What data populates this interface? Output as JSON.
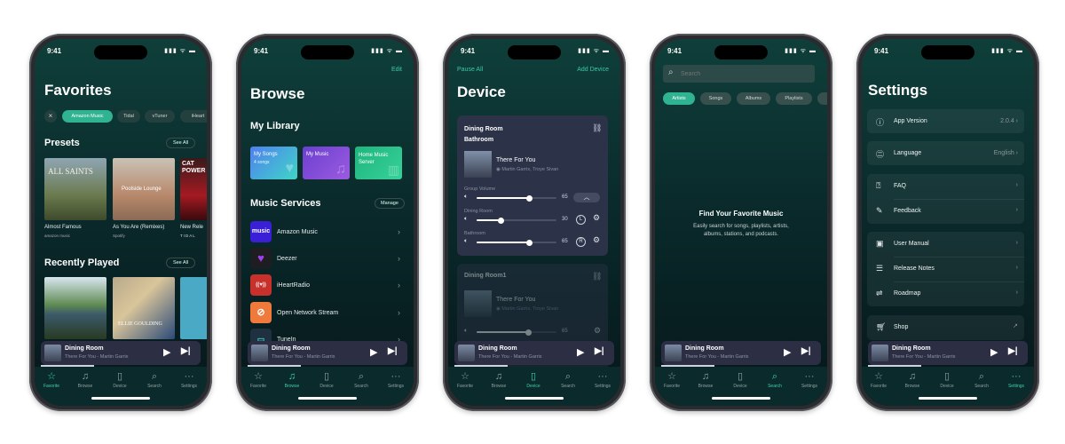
{
  "status": {
    "time": "9:41",
    "icons": "▮▮▮ ᯤ ▬"
  },
  "mini_player": {
    "title": "Dining Room",
    "subtitle": "There For You - Martin Garrix",
    "play_icon": "play-icon",
    "next_icon": "skip-next-icon"
  },
  "tab_bar": {
    "items": [
      {
        "label": "Favorite",
        "icon": "☆"
      },
      {
        "label": "Browse",
        "icon": "♫"
      },
      {
        "label": "Device",
        "icon": "▯"
      },
      {
        "label": "Search",
        "icon": "⌕"
      },
      {
        "label": "Settings",
        "icon": "···"
      }
    ]
  },
  "favorites": {
    "title": "Favorites",
    "chips": [
      "Amazon Music",
      "Tidal",
      "vTuner",
      "iHeart"
    ],
    "presets_title": "Presets",
    "see_all": "See All",
    "presets": [
      {
        "title": "Almost Famous",
        "source": "amazon music",
        "art_text": "ALL SAINTS"
      },
      {
        "title": "As You Are (Remixes)",
        "source": "Spotify",
        "art_text": "Poolside Lounge"
      },
      {
        "title": "New Rele",
        "source": "TIDAL",
        "art_text": "CAT POWER"
      }
    ],
    "recent_title": "Recently Played",
    "recent_art_text": "ELLIE GOULDING"
  },
  "browse": {
    "edit": "Edit",
    "title": "Browse",
    "library_title": "My Library",
    "library": [
      {
        "title": "My Songs",
        "sub": "4 songs",
        "color": "linear-gradient(135deg,#4f7ff0,#3fd6c6)"
      },
      {
        "title": "My Music",
        "sub": "",
        "color": "linear-gradient(135deg,#6a3fcf,#9c5be0)"
      },
      {
        "title": "Home Music Server",
        "sub": "",
        "color": "linear-gradient(135deg,#1fb57d,#36d19a)"
      }
    ],
    "services_title": "Music Services",
    "manage": "Manage",
    "services": [
      {
        "name": "Amazon Music",
        "icon_text": "music",
        "color": "#3b1fd6"
      },
      {
        "name": "Deezer",
        "icon_text": "♥",
        "color": "#1d1d22"
      },
      {
        "name": "iHeartRadio",
        "icon_text": "((♥))",
        "color": "#c8302c"
      },
      {
        "name": "Open Network Stream",
        "icon_text": "⊘",
        "color": "#f07a3b"
      },
      {
        "name": "TuneIn",
        "icon_text": "▭",
        "color": "#1f3040"
      }
    ]
  },
  "device": {
    "pause_all": "Pause All",
    "add_device": "Add Device",
    "title": "Device",
    "group": {
      "name_line1": "Dining Room",
      "name_line2": "Bathroom",
      "song": "There For You",
      "artist": "Martin Garrix, Troye Sivan",
      "volumes": [
        {
          "label": "Group Volume",
          "value": 65,
          "badge": ""
        },
        {
          "label": "Dining Room",
          "value": 30,
          "badge": "L"
        },
        {
          "label": "Bathroom",
          "value": 65,
          "badge": "R"
        }
      ]
    },
    "single": {
      "name": "Dining Room1",
      "song": "There For You",
      "artist": "Martin Garrix, Troye Sivan",
      "value": 65
    }
  },
  "search": {
    "placeholder": "Search",
    "chips": [
      "Artists",
      "Songs",
      "Albums",
      "Playlists"
    ],
    "empty_title": "Find Your Favorite Music",
    "empty_line1": "Easily search for songs, playlists, artists,",
    "empty_line2": "albums, stations, and podcasts."
  },
  "settings": {
    "title": "Settings",
    "app_version": {
      "label": "App Version",
      "value": "2.0.4"
    },
    "language": {
      "label": "Language",
      "value": "English"
    },
    "faq": "FAQ",
    "feedback": "Feedback",
    "user_manual": "User Manual",
    "release_notes": "Release Notes",
    "roadmap": "Roadmap",
    "shop": "Shop"
  },
  "colors": {
    "accent": "#39c9a3",
    "mini_player": "#2c2f44",
    "card": "#2c3247"
  }
}
